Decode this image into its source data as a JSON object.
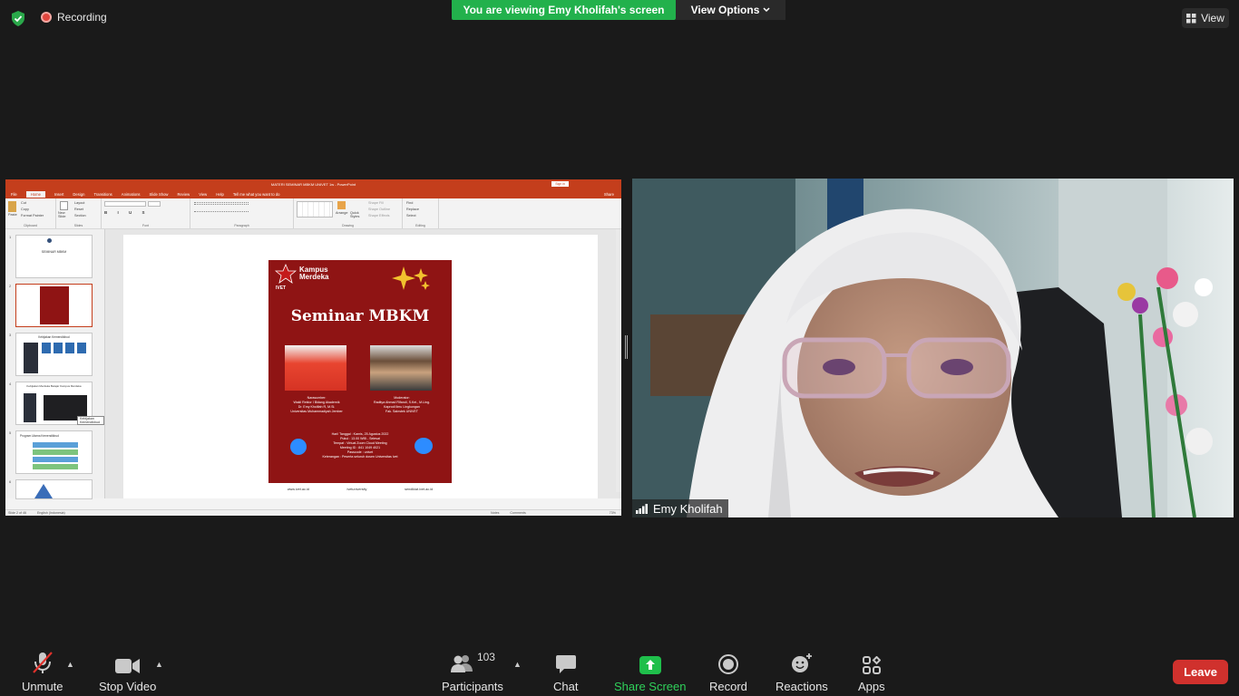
{
  "top": {
    "recording_label": "Recording",
    "viewing_banner": "You are viewing Emy Kholifah's screen",
    "view_options_label": "View Options",
    "view_label": "View"
  },
  "shared_screen": {
    "app_title": "MATERI SEMINAR MBKM UNIVET 1w - PowerPoint",
    "sign_in": "Sign in",
    "share": "Share",
    "tabs": [
      "File",
      "Home",
      "Insert",
      "Design",
      "Transitions",
      "Animations",
      "Slide Show",
      "Review",
      "View",
      "Help",
      "Tell me what you want to do"
    ],
    "ribbon_groups": [
      "Clipboard",
      "Slides",
      "Font",
      "Paragraph",
      "Drawing",
      "Editing"
    ],
    "ribbon_items": {
      "paste": "Paste",
      "cut": "Cut",
      "copy": "Copy",
      "format_painter": "Format Painter",
      "new_slide": "New Slide",
      "layout": "Layout",
      "reset": "Reset",
      "section": "Section",
      "arrange": "Arrange",
      "quick_styles": "Quick Styles",
      "shape_fill": "Shape Fill",
      "shape_outline": "Shape Outline",
      "shape_effects": "Shape Effects",
      "find": "Find",
      "replace": "Replace",
      "select": "Select"
    },
    "thumbnail_numbers": [
      "1",
      "2",
      "3",
      "4",
      "5",
      "6"
    ],
    "thumbnail_titles": {
      "t1": "SEMINAR MBKM",
      "t3": "Kebijakan Kemendikbud",
      "t4": "Kebijakan Merdeka Belajar Kampus Merdeka",
      "t5": "Program Utama Kemendikbud"
    },
    "tooltip": "Kebijakan Kemendikbud",
    "poster": {
      "brand_top": "Kampus",
      "brand_bottom": "Merdeka",
      "logo_text": "IVET",
      "title": "Seminar MBKM",
      "speaker_caption_1": "Narasumber:",
      "speaker_caption_2": "Wakil Rektor I Bidang Akademik",
      "speaker_caption_3": "Dr. Emy Kholifah R, M.Si.",
      "speaker_caption_4": "Universitas Muhammadiyah Jember",
      "moderator_caption_1": "Moderator:",
      "moderator_caption_2": "Raditya Ahmad Rifandi, S.Kel., M.Ling.",
      "moderator_caption_3": "Kaprodi Ilmu Lingkungan",
      "moderator_caption_4": "Fak. Sainstek UNIVET",
      "info_1": "Hari/ Tanggal : Kamis, 25 Agustus 2022",
      "info_2": "Pukul : 13.00 WIB - Selesai",
      "info_3": "Tempat : Virtual Zoom Cloud Meeting",
      "info_4": "Meeting ID : 841 1049 4021",
      "info_5": "Passcode : univet",
      "info_6": "Keterangan : Peserta seluruh dosen Universitas Ivet",
      "footer_web": "www.ivet.ac.id",
      "footer_ig": "ivetuniversity",
      "footer_mail": "sendikiat.ivet.ac.id"
    },
    "status": {
      "slide_count": "Slide 2 of 46",
      "language": "English (Indonesia)",
      "notes": "Notes",
      "comments": "Comments",
      "zoom": "73%"
    }
  },
  "video": {
    "participant_name": "Emy Kholifah"
  },
  "toolbar": {
    "unmute": "Unmute",
    "stop_video": "Stop Video",
    "participants": "Participants",
    "participant_count": "103",
    "chat": "Chat",
    "share_screen": "Share Screen",
    "record": "Record",
    "reactions": "Reactions",
    "apps": "Apps",
    "leave": "Leave"
  },
  "colors": {
    "share_green": "#22b14c",
    "leave_red": "#d0312d",
    "ppt_red": "#c43e1c",
    "poster_red": "#8f1414"
  }
}
